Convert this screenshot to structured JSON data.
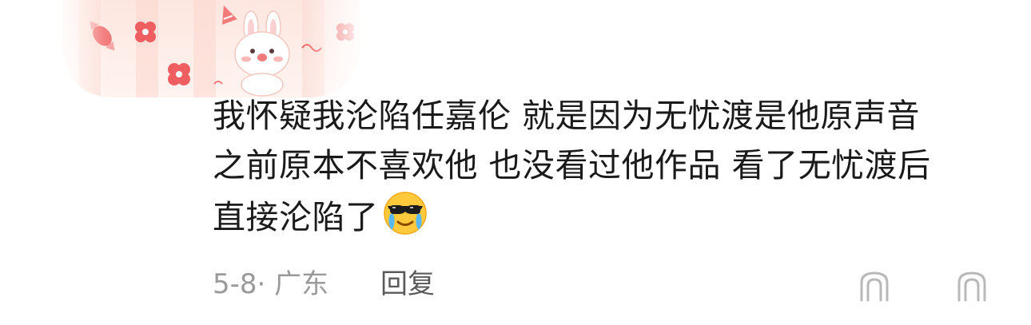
{
  "comment": {
    "lines": [
      "我怀疑我沦陷任嘉伦 就是因为无忧渡是他原声音",
      "之前原本不喜欢他 也没看过他作品 看了无忧渡后",
      "直接沦陷了"
    ],
    "emoji": "cool-crying-emoji"
  },
  "meta": {
    "date": "5-8",
    "separator": "·",
    "location": "广东",
    "reply_label": "回复"
  },
  "icons": {
    "decor": "bunny-candy-banner",
    "comment_action": "chat-bubble-icon",
    "like_action": "thumbs-up-icon"
  },
  "colors": {
    "text": "#1a1a1a",
    "meta": "#9a9a9a",
    "reply": "#5a5a5a",
    "banner_pink": "#fbd9d0"
  }
}
